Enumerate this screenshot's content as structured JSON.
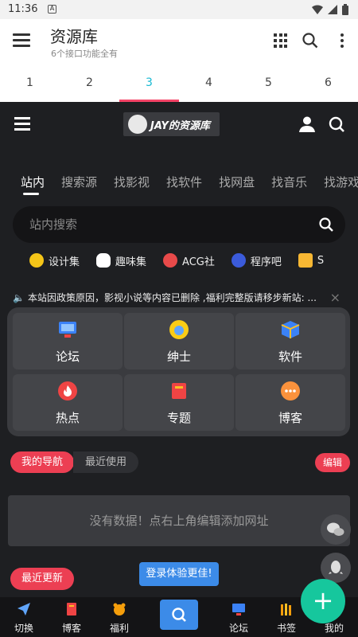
{
  "status": {
    "time": "11:36"
  },
  "appbar": {
    "title": "资源库",
    "subtitle": "6个接口功能全有"
  },
  "tabs": [
    "1",
    "2",
    "3",
    "4",
    "5",
    "6"
  ],
  "site": {
    "logo_text": "JAY的资源库",
    "categories": [
      "站内",
      "搜索源",
      "找影视",
      "找软件",
      "找网盘",
      "找音乐",
      "找游戏"
    ],
    "search_placeholder": "站内搜索",
    "quick_links": [
      "设计集",
      "趣味集",
      "ACG社",
      "程序吧",
      "S"
    ],
    "notice": "本站因政策原因，影视小说等内容已删除 ,福利完整版请移步新站: ...",
    "grid": [
      "论坛",
      "绅士",
      "软件",
      "热点",
      "专题",
      "博客"
    ],
    "my_nav": "我的导航",
    "recent_use": "最近使用",
    "edit": "编辑",
    "empty_text": "没有数据！点右上角编辑添加网址",
    "latest": "最近更新",
    "login_tip": "登录体验更佳!",
    "bottom_nav": [
      "切换",
      "博客",
      "福利",
      "论坛",
      "书签",
      "我的"
    ]
  },
  "colors": {
    "accent_red": "#ec3f53",
    "accent_blue": "#3c8be8",
    "accent_green": "#16c79d",
    "tab_active": "#17b9d2"
  }
}
